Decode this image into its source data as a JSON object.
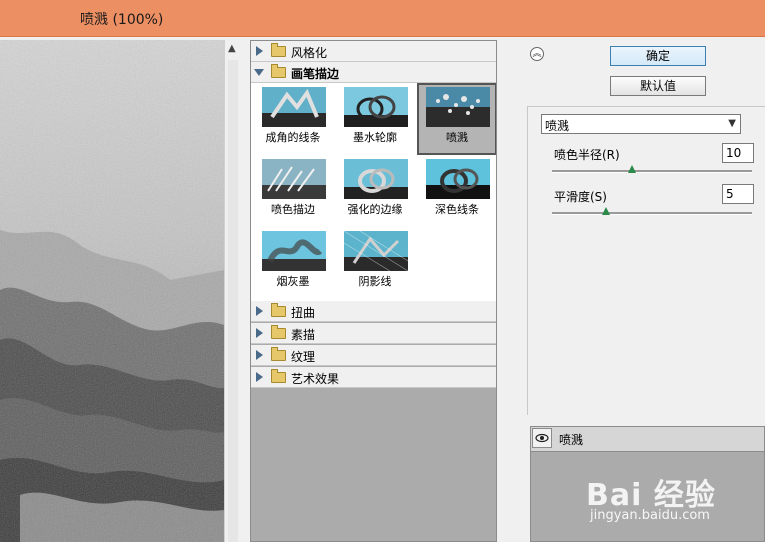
{
  "window": {
    "title": "喷溅 (100%)"
  },
  "gallery": {
    "categories_top": [
      {
        "label": "风格化",
        "expanded": false
      },
      {
        "label": "画笔描边",
        "expanded": true
      }
    ],
    "thumbnails": [
      {
        "label": "成角的线条",
        "selected": false
      },
      {
        "label": "墨水轮廓",
        "selected": false
      },
      {
        "label": "喷溅",
        "selected": true
      },
      {
        "label": "喷色描边",
        "selected": false
      },
      {
        "label": "强化的边缘",
        "selected": false
      },
      {
        "label": "深色线条",
        "selected": false
      },
      {
        "label": "烟灰墨",
        "selected": false
      },
      {
        "label": "阴影线",
        "selected": false
      }
    ],
    "categories_bottom": [
      {
        "label": "扭曲",
        "expanded": false
      },
      {
        "label": "素描",
        "expanded": false
      },
      {
        "label": "纹理",
        "expanded": false
      },
      {
        "label": "艺术效果",
        "expanded": false
      }
    ]
  },
  "buttons": {
    "ok": "确定",
    "default": "默认值"
  },
  "filter_select": {
    "value": "喷溅"
  },
  "params": {
    "spray_radius": {
      "label": "喷色半径(R)",
      "value": "10",
      "fraction": 0.4
    },
    "smoothness": {
      "label": "平滑度(S)",
      "value": "5",
      "fraction": 0.27
    }
  },
  "layers": {
    "items": [
      {
        "name": "喷溅"
      }
    ]
  },
  "watermark": {
    "main": "Bai 经验",
    "sub": "jingyan.baidu.com"
  },
  "colors": {
    "titlebar": "#ec8f63",
    "selected_thumb": "#b4b4b4",
    "slider_knob": "#2a8a4a"
  }
}
